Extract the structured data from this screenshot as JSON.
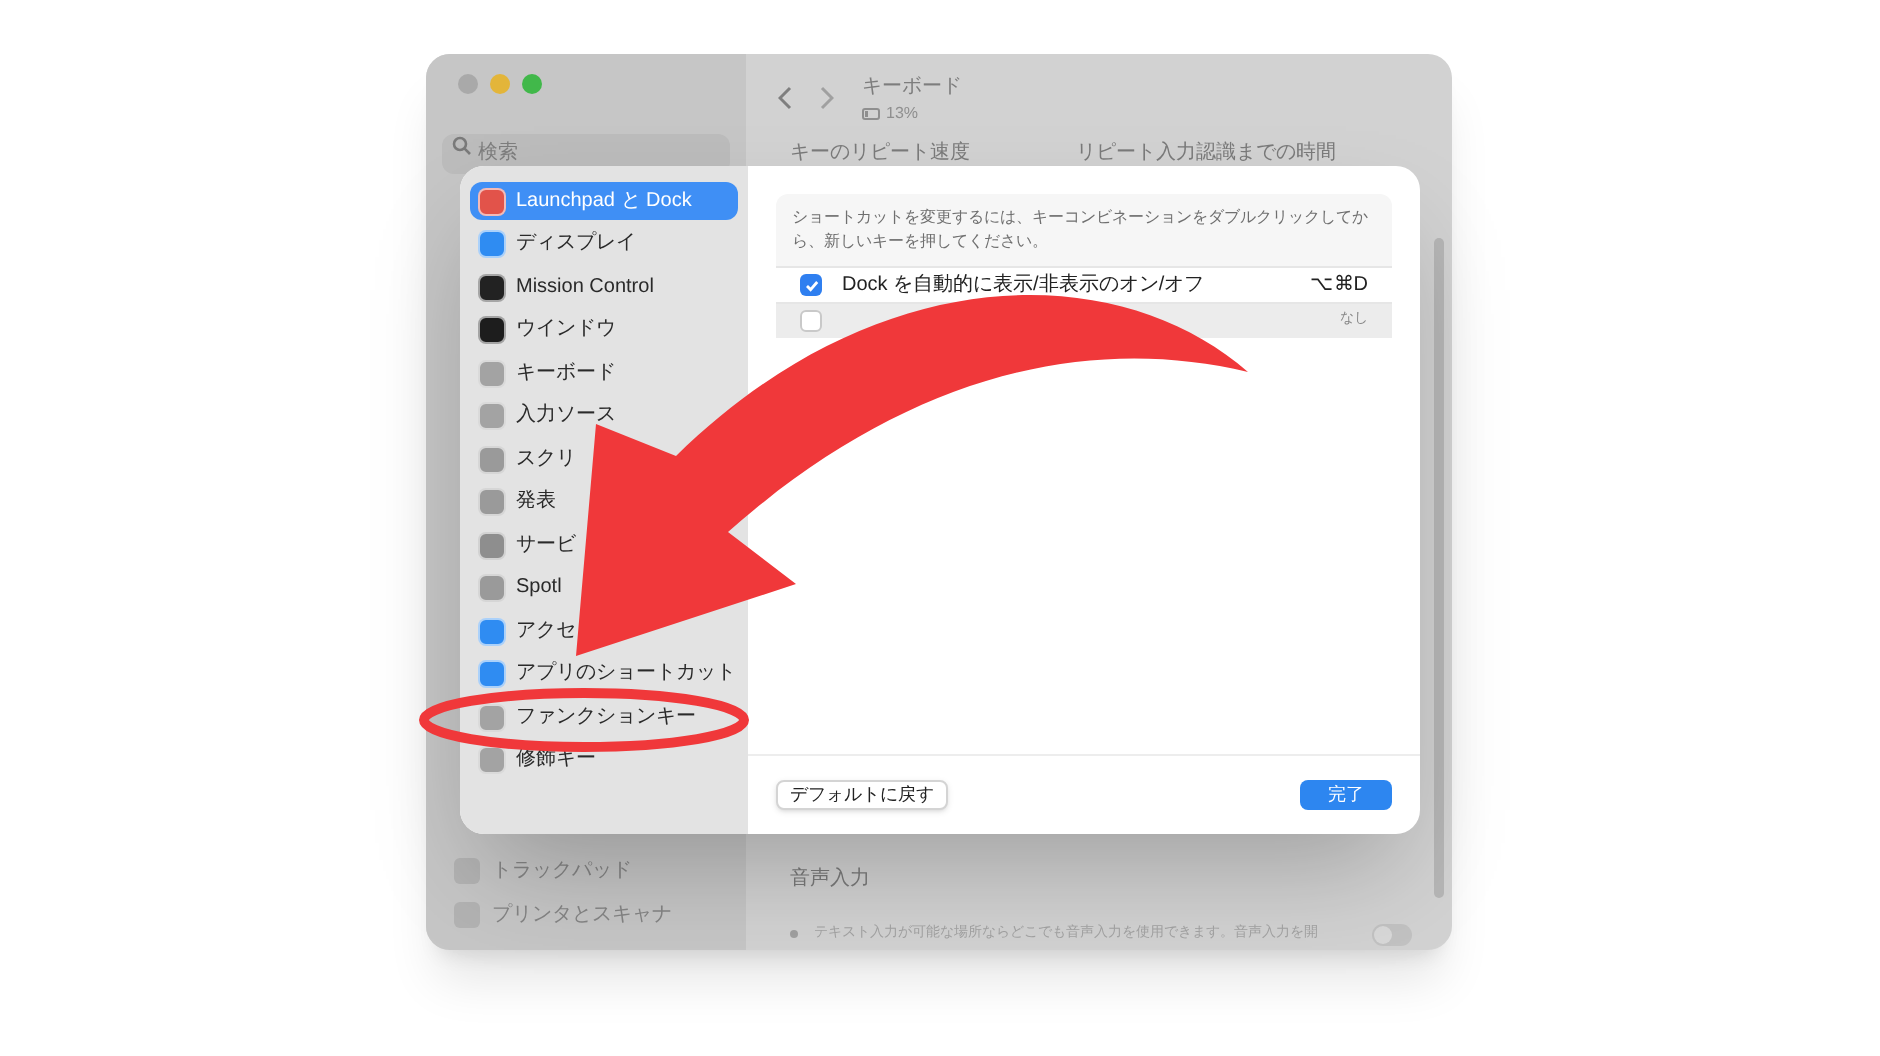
{
  "background_window": {
    "title": "キーボード",
    "battery": "13%",
    "search": {
      "placeholder": "検索"
    },
    "sidebar_items": [
      "トラックパッド",
      "プリンタとスキャナ"
    ],
    "sections": [
      "キーのリピート速度",
      "リピート入力認識までの時間",
      "音声入力"
    ],
    "dictation_note": "テキスト入力が可能な場所ならどこでも音声入力を使用できます。音声入力を開",
    "dictation_on": false
  },
  "sheet": {
    "sidebar": [
      {
        "label": "Launchpad と Dock",
        "selected": true
      },
      {
        "label": "ディスプレイ",
        "selected": false
      },
      {
        "label": "Mission Control",
        "selected": false
      },
      {
        "label": "ウインドウ",
        "selected": false
      },
      {
        "label": "キーボード",
        "selected": false
      },
      {
        "label": "入力ソース",
        "selected": false
      },
      {
        "label": "スクリ",
        "selected": false
      },
      {
        "label": "発表",
        "selected": false
      },
      {
        "label": "サービ",
        "selected": false
      },
      {
        "label": "Spotl",
        "selected": false
      },
      {
        "label": "アクセ",
        "selected": false
      },
      {
        "label": "アプリのショートカット",
        "selected": false
      },
      {
        "label": "ファンクションキー",
        "selected": false
      },
      {
        "label": "修飾キー",
        "selected": false
      }
    ],
    "hint": "ショートカットを変更するには、キーコンビネーションをダブルクリックしてから、新しいキーを押してください。",
    "shortcuts": [
      {
        "label": "Dock を自動的に表示/非表示のオン/オフ",
        "checked": true,
        "keys": "⌥⌘D"
      },
      {
        "checked": false,
        "keys": "なし"
      }
    ],
    "buttons": [
      {
        "label": "デフォルトに戻す",
        "kind": "secondary"
      },
      {
        "label": "完了",
        "kind": "primary"
      }
    ]
  }
}
